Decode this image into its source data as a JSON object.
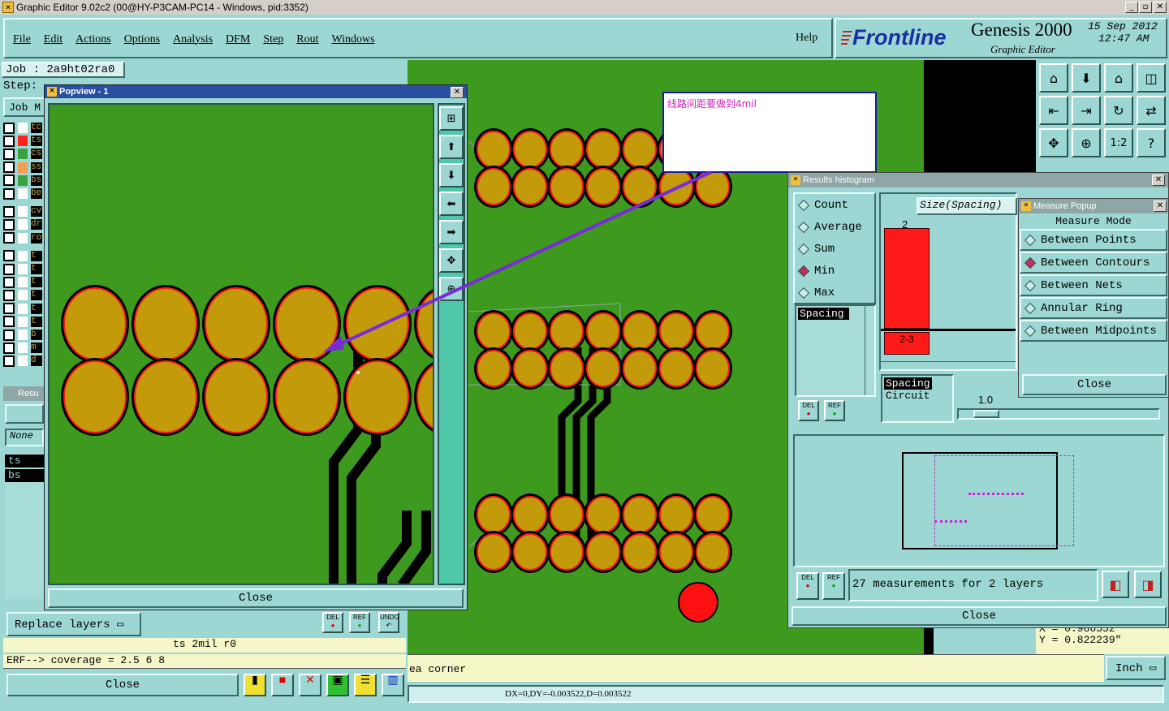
{
  "window": {
    "title": "Graphic Editor 9.02c2 (00@HY-P3CAM-PC14 - Windows, pid:3352)"
  },
  "menu": [
    "File",
    "Edit",
    "Actions",
    "Options",
    "Analysis",
    "DFM",
    "Step",
    "Rout",
    "Windows"
  ],
  "help_label": "Help",
  "brand": {
    "logo": "Frontline",
    "product": "Genesis 2000",
    "sub": "Graphic Editor",
    "date": "15 Sep 2012",
    "time": "12:47 AM"
  },
  "job": {
    "job_line": "Job : 2a9ht02ra0",
    "step_line": "Step:",
    "job_button": "Job M"
  },
  "layers": [
    {
      "name": "tc",
      "color": "#ffffff"
    },
    {
      "name": "ts",
      "color": "#ff2020"
    },
    {
      "name": "cs",
      "color": "#3aa040"
    },
    {
      "name": "ss",
      "color": "#f0a050"
    },
    {
      "name": "bs",
      "color": "#3aa040"
    },
    {
      "name": "be",
      "color": "#ffffff"
    },
    {
      "name": "cv",
      "color": "#ffffff"
    },
    {
      "name": "dr",
      "color": "#ffffff"
    },
    {
      "name": "ro",
      "color": "#ffffff"
    },
    {
      "name": "t",
      "color": "#ffffff"
    },
    {
      "name": "t",
      "color": "#ffffff"
    },
    {
      "name": "t",
      "color": "#ffffff"
    },
    {
      "name": "t",
      "color": "#ffffff"
    },
    {
      "name": "t",
      "color": "#ffffff"
    },
    {
      "name": "t",
      "color": "#ffffff"
    },
    {
      "name": "b",
      "color": "#ffffff"
    },
    {
      "name": "m",
      "color": "#ffffff"
    },
    {
      "name": "d",
      "color": "#ffffff"
    }
  ],
  "popview": {
    "title": "Popview - 1",
    "close": "Close"
  },
  "annotation": {
    "text": "线路间距要做到4mil"
  },
  "results_panel": {
    "title": "Resu",
    "none": "None",
    "items": [
      "ts",
      "bs"
    ]
  },
  "bottom_left": {
    "replace_layers": "Replace layers",
    "del": "DEL",
    "ref": "REF",
    "undo": "UNDO",
    "info": "ts 2mil  r0",
    "erf": "ERF--> coverage = 2.5 6 8",
    "close": "Close"
  },
  "status": {
    "corner_text": "ea corner",
    "units": "Inch",
    "coords": "DX=0,DY=-0.003522,D=0.003522",
    "x": "X = 0.986552\"",
    "y": "Y = 0.822239\""
  },
  "histogram": {
    "title": "Results histogram",
    "options": [
      "Count",
      "Average",
      "Sum",
      "Min",
      "Max"
    ],
    "selected": "Min",
    "list_item": "Spacing",
    "size_label": "Size(Spacing)",
    "bar_value": "2",
    "bar_range": "2-3",
    "types": [
      "Spacing",
      "Circuit"
    ],
    "slider_value": "1.0",
    "del": "DEL",
    "ref": "REF",
    "summary": "27 measurements for 2 layers",
    "close": "Close"
  },
  "measure": {
    "title": "Measure Popup",
    "mode_label": "Measure Mode",
    "options": [
      "Between Points",
      "Between Contours",
      "Between Nets",
      "Annular Ring",
      "Between Midpoints"
    ],
    "selected": "Between Contours",
    "close": "Close"
  },
  "colors": {
    "board": "#3e9a1e",
    "pad": "#c29a0a",
    "outline": "#ff1a1a",
    "trace": "#000000",
    "annot_arrow": "#7a2bd8",
    "panel": "#9cd7d4"
  }
}
